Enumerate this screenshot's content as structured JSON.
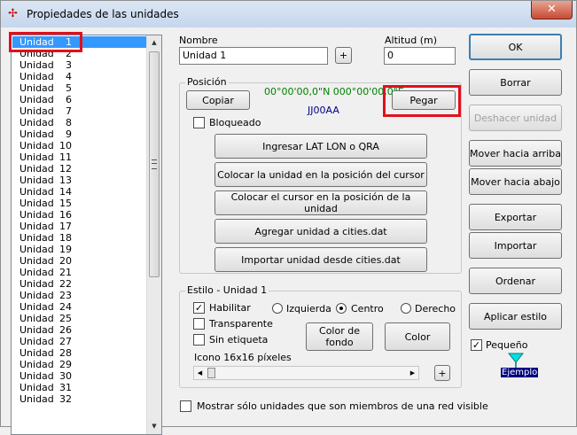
{
  "window": {
    "title": "Propiedades de las unidades",
    "close_label": "✕"
  },
  "unit_list": {
    "items": [
      {
        "name": "Unidad",
        "num": "1"
      },
      {
        "name": "Unidad",
        "num": "2"
      },
      {
        "name": "Unidad",
        "num": "3"
      },
      {
        "name": "Unidad",
        "num": "4"
      },
      {
        "name": "Unidad",
        "num": "5"
      },
      {
        "name": "Unidad",
        "num": "6"
      },
      {
        "name": "Unidad",
        "num": "7"
      },
      {
        "name": "Unidad",
        "num": "8"
      },
      {
        "name": "Unidad",
        "num": "9"
      },
      {
        "name": "Unidad",
        "num": "10"
      },
      {
        "name": "Unidad",
        "num": "11"
      },
      {
        "name": "Unidad",
        "num": "12"
      },
      {
        "name": "Unidad",
        "num": "13"
      },
      {
        "name": "Unidad",
        "num": "14"
      },
      {
        "name": "Unidad",
        "num": "15"
      },
      {
        "name": "Unidad",
        "num": "16"
      },
      {
        "name": "Unidad",
        "num": "17"
      },
      {
        "name": "Unidad",
        "num": "18"
      },
      {
        "name": "Unidad",
        "num": "19"
      },
      {
        "name": "Unidad",
        "num": "20"
      },
      {
        "name": "Unidad",
        "num": "21"
      },
      {
        "name": "Unidad",
        "num": "22"
      },
      {
        "name": "Unidad",
        "num": "23"
      },
      {
        "name": "Unidad",
        "num": "24"
      },
      {
        "name": "Unidad",
        "num": "25"
      },
      {
        "name": "Unidad",
        "num": "26"
      },
      {
        "name": "Unidad",
        "num": "27"
      },
      {
        "name": "Unidad",
        "num": "28"
      },
      {
        "name": "Unidad",
        "num": "29"
      },
      {
        "name": "Unidad",
        "num": "30"
      },
      {
        "name": "Unidad",
        "num": "31"
      },
      {
        "name": "Unidad",
        "num": "32"
      }
    ],
    "selected_index": 0
  },
  "name_field": {
    "label": "Nombre",
    "value": "Unidad   1",
    "plus_label": "+"
  },
  "altitude_field": {
    "label": "Altitud (m)",
    "value": "0"
  },
  "position": {
    "title": "Posición",
    "copy_label": "Copiar",
    "paste_label": "Pegar",
    "coordinates": "00°00'00,0\"N 000°00'00,0\"E",
    "qra": "JJ00AA",
    "locked_label": "Bloqueado",
    "locked": false,
    "enter_latlon_label": "Ingresar LAT LON o QRA",
    "place_unit_label": "Colocar la unidad en la posición del cursor",
    "place_cursor_label": "Colocar el cursor en la posición de la unidad",
    "add_city_label": "Agregar unidad a cities.dat",
    "import_city_label": "Importar unidad desde cities.dat"
  },
  "style": {
    "title": "Estilo - Unidad    1",
    "enable_label": "Habilitar",
    "enabled": true,
    "transparent_label": "Transparente",
    "no_label_label": "Sin etiqueta",
    "align_left_label": "Izquierda",
    "align_center_label": "Centro",
    "align_right_label": "Derecho",
    "align_selected": "center",
    "bg_color_label": "Color de\nfondo",
    "color_label": "Color",
    "icon_label": "Icono 16x16 píxeles",
    "plus_label": "+"
  },
  "show_network_label": "Mostrar sólo unidades que son miembros de una red visible",
  "side_buttons": {
    "ok": "OK",
    "delete": "Borrar",
    "undo": "Deshacer unidad",
    "move_up": "Mover hacia arriba",
    "move_down": "Mover hacia abajo",
    "export": "Exportar",
    "import": "Importar",
    "sort": "Ordenar",
    "apply_style": "Aplicar estilo"
  },
  "small_label": "Pequeño",
  "small_checked": true,
  "sample_label": "Ejemplo",
  "colors": {
    "highlight": "#e0101e",
    "selection": "#3399ff",
    "coords": "#008000",
    "qra": "#000080",
    "sample_marker": "#00e0e0"
  }
}
